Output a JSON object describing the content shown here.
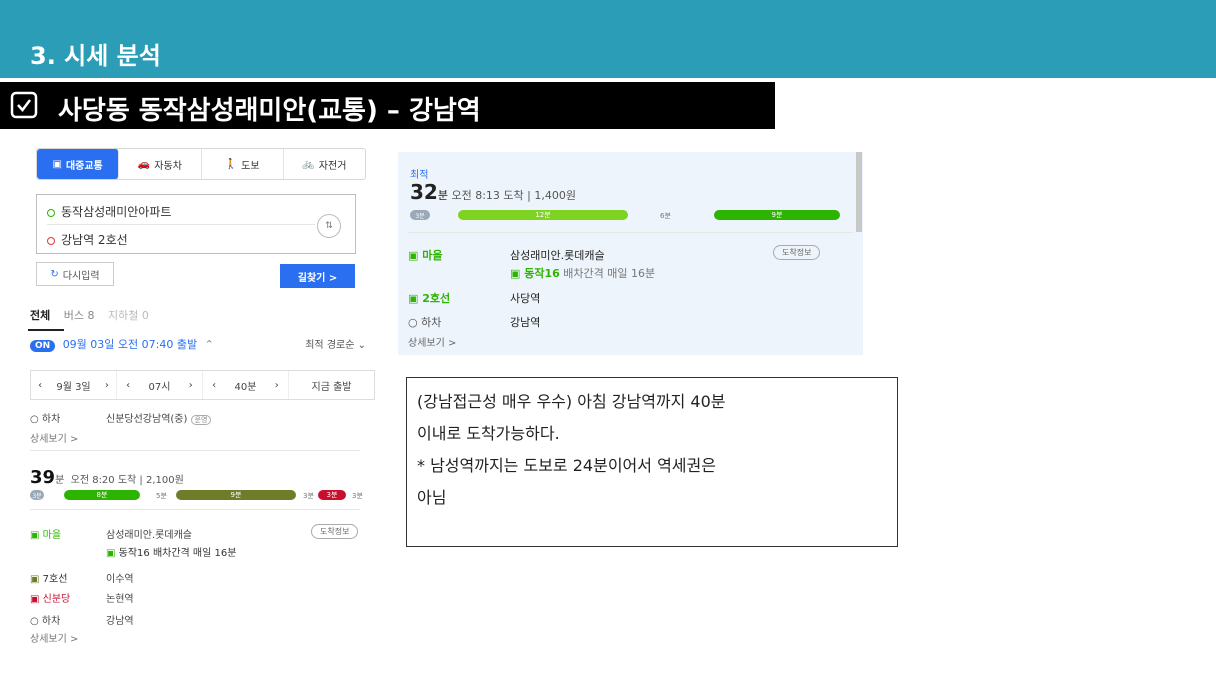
{
  "header": {
    "section_title": "3. 시세 분석"
  },
  "title_bar": {
    "title": "사당동 동작삼성래미안(교통) – 강남역"
  },
  "left_panel": {
    "tabs": [
      {
        "label": "대중교통",
        "icon": "bus-icon"
      },
      {
        "label": "자동차",
        "icon": "car-icon"
      },
      {
        "label": "도보",
        "icon": "walk-icon"
      },
      {
        "label": "자전거",
        "icon": "bike-icon"
      }
    ],
    "origin": "동작삼성래미안아파트",
    "destination": "강남역 2호선",
    "reset_label": "다시입력",
    "search_label": "길찾기 >",
    "subtabs": [
      "전체",
      "버스 8",
      "지하철 0"
    ],
    "on_badge": "ON",
    "depart_text": "09월 03일 오전 07:40 출발",
    "sort_label": "최적 경로순",
    "steppers": [
      {
        "prev": "‹",
        "value": "9월 3일",
        "next": "›"
      },
      {
        "prev": "‹",
        "value": "07시",
        "next": "›"
      },
      {
        "prev": "‹",
        "value": "40분",
        "next": "›"
      },
      {
        "prev": "",
        "value": "지금 출발",
        "next": ""
      }
    ],
    "prev_route": {
      "alight_label": "하차",
      "alight_stop": "신분당선강남역(중)",
      "alight_tag": "운영",
      "detail_link": "상세보기 >"
    },
    "route2": {
      "minutes": "39",
      "minutes_unit": "분",
      "summary": "오전 8:20 도착 | 2,100원",
      "bars": [
        "3분",
        "8분",
        "5분",
        "9분",
        "3분",
        "3분",
        "3분"
      ],
      "steps": [
        {
          "line": "마을",
          "stop": "삼성래미안.롯데캐슬",
          "color": "#2db400"
        },
        {
          "line": "",
          "stop": "동작16  배차간격 매일 16분",
          "color": "#2db400"
        },
        {
          "line": "7호선",
          "stop": "이수역",
          "color": "#6f7d2a"
        },
        {
          "line": "신분당",
          "stop": "논현역",
          "color": "#c8102e"
        },
        {
          "line": "하차",
          "stop": "강남역",
          "color": "#777"
        }
      ],
      "info_btn": "도착정보",
      "detail_link": "상세보기 >"
    }
  },
  "right_panel": {
    "best_label": "최적",
    "minutes": "32",
    "minutes_unit": "분",
    "summary": "오전 8:13 도착 | 1,400원",
    "bars": [
      "3분",
      "12분",
      "6분",
      "9분"
    ],
    "steps": [
      {
        "line": "마을",
        "stop": "삼성래미안.롯데캐슬"
      },
      {
        "line": "",
        "stop": "동작16",
        "extra": "배차간격 매일 16분"
      },
      {
        "line": "2호선",
        "stop": "사당역"
      },
      {
        "line": "하차",
        "stop": "강남역"
      }
    ],
    "info_btn": "도착정보",
    "detail_link": "상세보기 >"
  },
  "note": {
    "lines": [
      "(강남접근성 매우 우수) 아침 강남역까지 40분",
      "이내로 도착가능하다.",
      "* 남성역까지는 도보로 24분이어서 역세권은",
      "아님"
    ]
  },
  "colors": {
    "accent": "#2b9db6",
    "blue": "#2a6ff0",
    "green": "#2db400",
    "olive": "#6f7d2a",
    "red": "#c8102e"
  }
}
